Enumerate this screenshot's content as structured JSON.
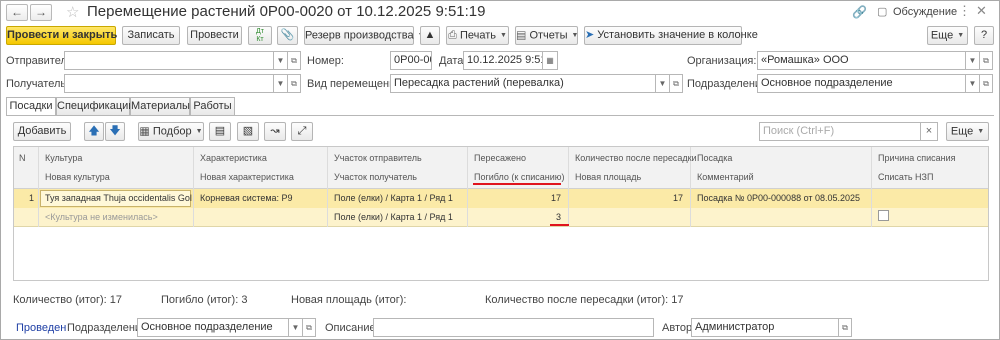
{
  "window": {
    "title": "Перемещение растений 0Р00-0020 от 10.12.2025 9:51:19",
    "discussion_label": "Обсуждение"
  },
  "toolbar": {
    "post_close": "Провести и закрыть",
    "save": "Записать",
    "post": "Провести",
    "reserve": "Резерв производства",
    "print": "Печать",
    "reports": "Отчеты",
    "set_column": "Установить значение в колонке",
    "more": "Еще",
    "help": "?"
  },
  "header": {
    "sender_label": "Отправитель:",
    "sender_value": "",
    "recipient_label": "Получатель:",
    "recipient_value": "",
    "number_label": "Номер:",
    "number_value": "0Р00-0020",
    "date_label": "Дата:",
    "date_value": "10.12.2025  9:51:19",
    "org_label": "Организация:",
    "org_value": "«Ромашка» ООО",
    "move_type_label": "Вид перемещения:",
    "move_type_value": "Пересадка растений (перевалка)",
    "division_label": "Подразделение:",
    "division_value": "Основное подразделение"
  },
  "tabs": [
    "Посадки",
    "Спецификации",
    "Материалы",
    "Работы"
  ],
  "table_toolbar": {
    "add": "Добавить",
    "pick": "Подбор",
    "search_placeholder": "Поиск (Ctrl+F)",
    "clear": "×",
    "more": "Еще"
  },
  "table": {
    "header_row1": [
      "N",
      "Культура",
      "Характеристика",
      "Участок отправитель",
      "Пересажено",
      "Количество после пересадки",
      "Посадка",
      "Причина списания"
    ],
    "header_row2": [
      "",
      "Новая культура",
      "Новая характеристика",
      "Участок получатель",
      "Погибло (к списанию)",
      "Новая площадь",
      "Комментарий",
      "Списать НЗП"
    ],
    "rows": [
      {
        "n": "1",
        "culture": "Туя западная Thuja occidentalis Golden...",
        "characteristic": "Корневая система: Р9",
        "sender_plot": "Поле (елки) / Карта 1 / Ряд 1",
        "transplanted": "17",
        "qty_after": "17",
        "planting": "Посадка № 0Р00-000088 от 08.05.2025",
        "write_off_reason": "",
        "new_culture": "<Культура не изменилась>",
        "new_characteristic": "",
        "recipient_plot": "Поле (елки) / Карта 1 / Ряд 1",
        "died": "3",
        "new_area": "",
        "comment": "",
        "write_off_wip": false
      }
    ]
  },
  "totals": {
    "qty": "Количество (итог): 17",
    "died": "Погибло (итог): 3",
    "new_area": "Новая площадь (итог):",
    "qty_after": "Количество после пересадки (итог): 17"
  },
  "footer": {
    "status": "Проведен",
    "division_label": "Подразделение:",
    "division_value": "Основное подразделение",
    "description_label": "Описание:",
    "description_value": "",
    "author_label": "Автор:",
    "author_value": "Администратор"
  },
  "colors": {
    "accent_yellow": "#f5c800",
    "row_selected": "#fbeaa7",
    "row_selected_alt": "#fdf3cc",
    "status_link": "#1f3fa5",
    "annotation_red": "#e0141e"
  }
}
